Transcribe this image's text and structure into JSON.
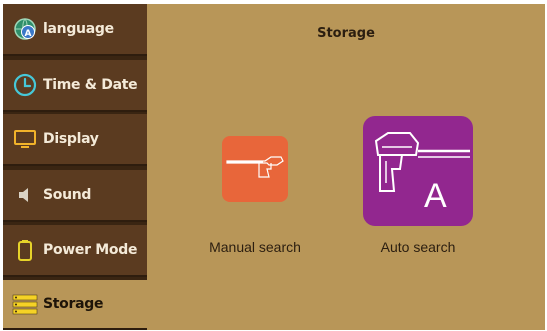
{
  "sidebar": {
    "items": [
      {
        "label": "language",
        "icon": "globe-language-icon"
      },
      {
        "label": "Time & Date",
        "icon": "clock-icon"
      },
      {
        "label": "Display",
        "icon": "monitor-icon"
      },
      {
        "label": "Sound",
        "icon": "speaker-icon"
      },
      {
        "label": "Power Mode",
        "icon": "battery-icon"
      },
      {
        "label": "Storage",
        "icon": "storage-icon",
        "selected": true
      }
    ]
  },
  "main": {
    "title": "Storage",
    "options": [
      {
        "label": "Manual search",
        "icon": "detector-icon",
        "color": "#e8663a"
      },
      {
        "label": "Auto search",
        "icon": "detector-auto-icon",
        "badge": "A",
        "color": "#92278f"
      }
    ]
  }
}
